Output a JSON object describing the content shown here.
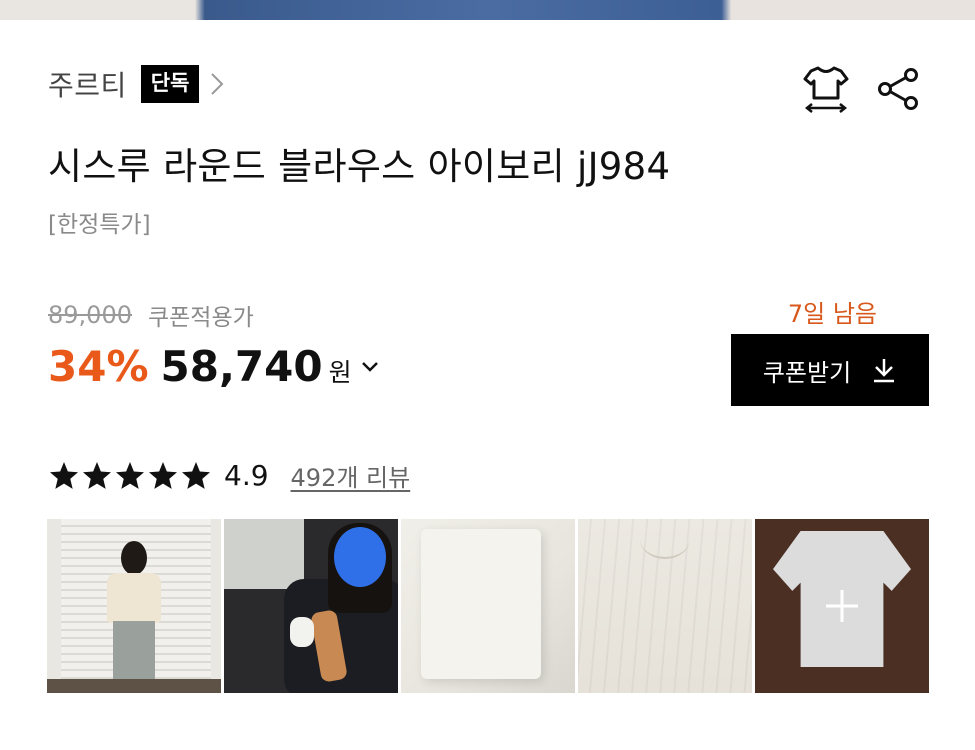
{
  "brand": {
    "name": "주르티",
    "badge": "단독"
  },
  "product": {
    "title": "시스루 라운드 블라우스 아이보리 jJ984",
    "subtitle": "[한정특가]"
  },
  "price": {
    "original": "89,000",
    "coupon_note": "쿠폰적용가",
    "discount": "34%",
    "sale": "58,740",
    "currency": "원"
  },
  "coupon": {
    "days_left": "7일 남음",
    "button_label": "쿠폰받기"
  },
  "rating": {
    "stars": 5,
    "score": "4.9",
    "review_link": "492개 리뷰"
  },
  "icons": {
    "size_guide": "tshirt-size-icon",
    "share": "share-icon"
  },
  "colors": {
    "accent_orange": "#e8591a",
    "black": "#000000",
    "gray_text": "#8a8a8a"
  }
}
